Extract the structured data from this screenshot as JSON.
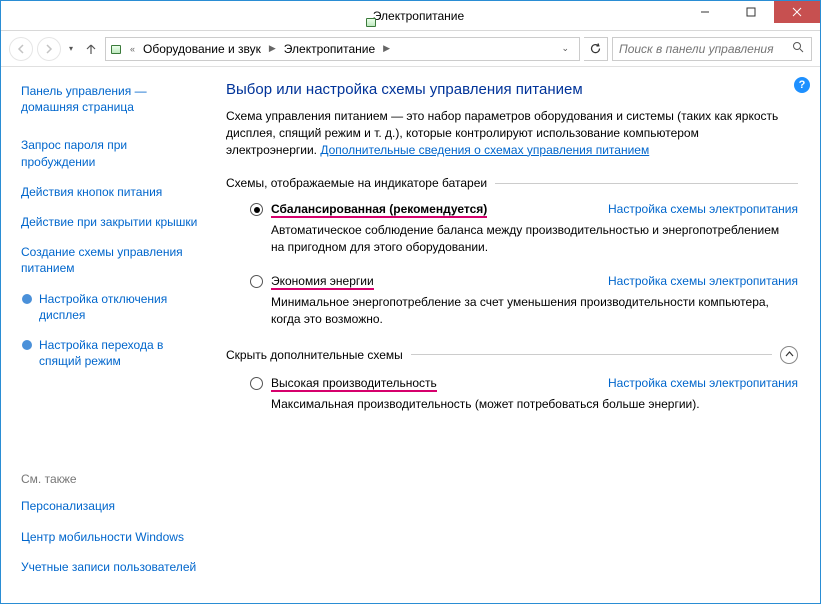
{
  "titlebar": {
    "title": "Электропитание"
  },
  "breadcrumb": {
    "items": [
      "Оборудование и звук",
      "Электропитание"
    ]
  },
  "search": {
    "placeholder": "Поиск в панели управления"
  },
  "sidebar": {
    "home": "Панель управления — домашняя страница",
    "links": {
      "l0": "Запрос пароля при пробуждении",
      "l1": "Действия кнопок питания",
      "l2": "Действие при закрытии крышки",
      "l3": "Создание схемы управления питанием",
      "l4": "Настройка отключения дисплея",
      "l5": "Настройка перехода в спящий режим"
    },
    "see_also_title": "См. также",
    "see_also": {
      "s0": "Персонализация",
      "s1": "Центр мобильности Windows",
      "s2": "Учетные записи пользователей"
    }
  },
  "content": {
    "title": "Выбор или настройка схемы управления питанием",
    "desc_a": "Схема управления питанием — это набор параметров оборудования и системы (таких как яркость дисплея, спящий режим и т. д.), которые контролируют использование компьютером электроэнергии. ",
    "desc_link": "Дополнительные сведения о схемах управления питанием",
    "fs1_legend": "Схемы, отображаемые на индикаторе батареи",
    "plan1_name": "Сбалансированная (рекомендуется)",
    "plan1_desc": "Автоматическое соблюдение баланса между производительностью и энергопотреблением на пригодном для этого оборудовании.",
    "plan2_name": "Экономия энергии",
    "plan2_desc": "Минимальное энергопотребление за счет уменьшения производительности компьютера, когда это возможно.",
    "fs2_legend": "Скрыть дополнительные схемы",
    "plan3_name": "Высокая производительность",
    "plan3_desc": "Максимальная производительность (может потребоваться больше энергии).",
    "config_label": "Настройка схемы электропитания"
  }
}
